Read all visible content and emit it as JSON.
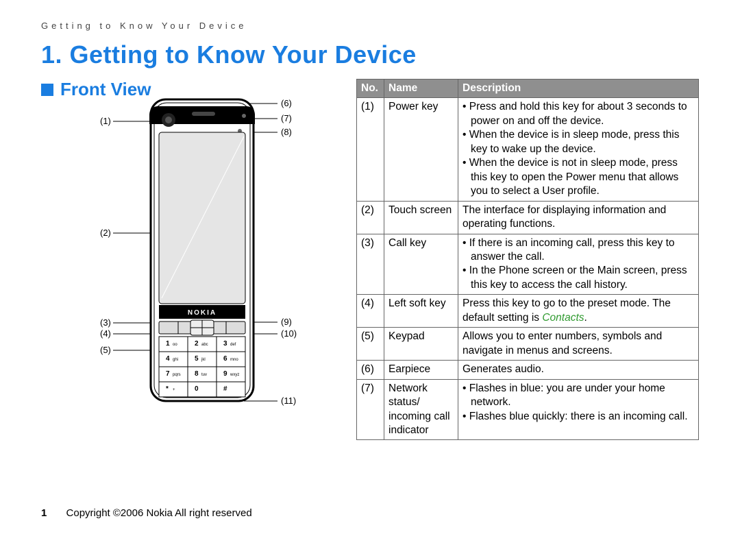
{
  "running_header": "Getting to Know Your Device",
  "section_title": "1.  Getting to Know Your Device",
  "subsection_title": "Front View",
  "page_number": "1",
  "copyright": "Copyright ©2006 Nokia All right reserved",
  "callouts": {
    "c1": "(1)",
    "c2": "(2)",
    "c3": "(3)",
    "c4": "(4)",
    "c5": "(5)",
    "c6": "(6)",
    "c7": "(7)",
    "c8": "(8)",
    "c9": "(9)",
    "c10": "(10)",
    "c11": "(11)"
  },
  "table": {
    "headers": [
      "No.",
      "Name",
      "Description"
    ],
    "rows": [
      {
        "no": "(1)",
        "name": "Power key",
        "bullets": [
          "Press and hold this key for about 3 seconds to power on and off the device.",
          "When the device is in sleep mode, press this key to wake up the device.",
          "When the device is not in sleep mode, press this key to open the Power menu that allows you to select a User profile."
        ]
      },
      {
        "no": "(2)",
        "name": "Touch screen",
        "plain": "The interface for displaying information and operating functions."
      },
      {
        "no": "(3)",
        "name": "Call key",
        "bullets": [
          "If there is an incoming call, press this key to answer the call.",
          "In the Phone screen or the Main screen, press this key to access the call history."
        ]
      },
      {
        "no": "(4)",
        "name": "Left soft key",
        "plain_pre": "Press this key to go to the preset mode. The default setting is ",
        "em": "Contacts",
        "plain_post": "."
      },
      {
        "no": "(5)",
        "name": "Keypad",
        "plain": "Allows you to enter numbers, symbols and navigate in menus and screens."
      },
      {
        "no": "(6)",
        "name": "Earpiece",
        "plain": "Generates audio."
      },
      {
        "no": "(7)",
        "name": "Network status/ incoming call indicator",
        "bullets": [
          "Flashes in blue: you are under your home network.",
          "Flashes blue quickly: there is an incoming call."
        ]
      }
    ]
  },
  "phone": {
    "brand": "NOKIA",
    "keys": [
      [
        "1",
        "2",
        "3"
      ],
      [
        "4",
        "5",
        "6"
      ],
      [
        "7",
        "8",
        "9"
      ],
      [
        "*",
        "0",
        "#"
      ]
    ],
    "sublabels": [
      [
        "oo",
        "abc",
        "def"
      ],
      [
        "ghi",
        "jkl",
        "mno"
      ],
      [
        "pqrs",
        "tuv",
        "wxyz"
      ],
      [
        "+",
        "",
        ""
      ]
    ]
  }
}
